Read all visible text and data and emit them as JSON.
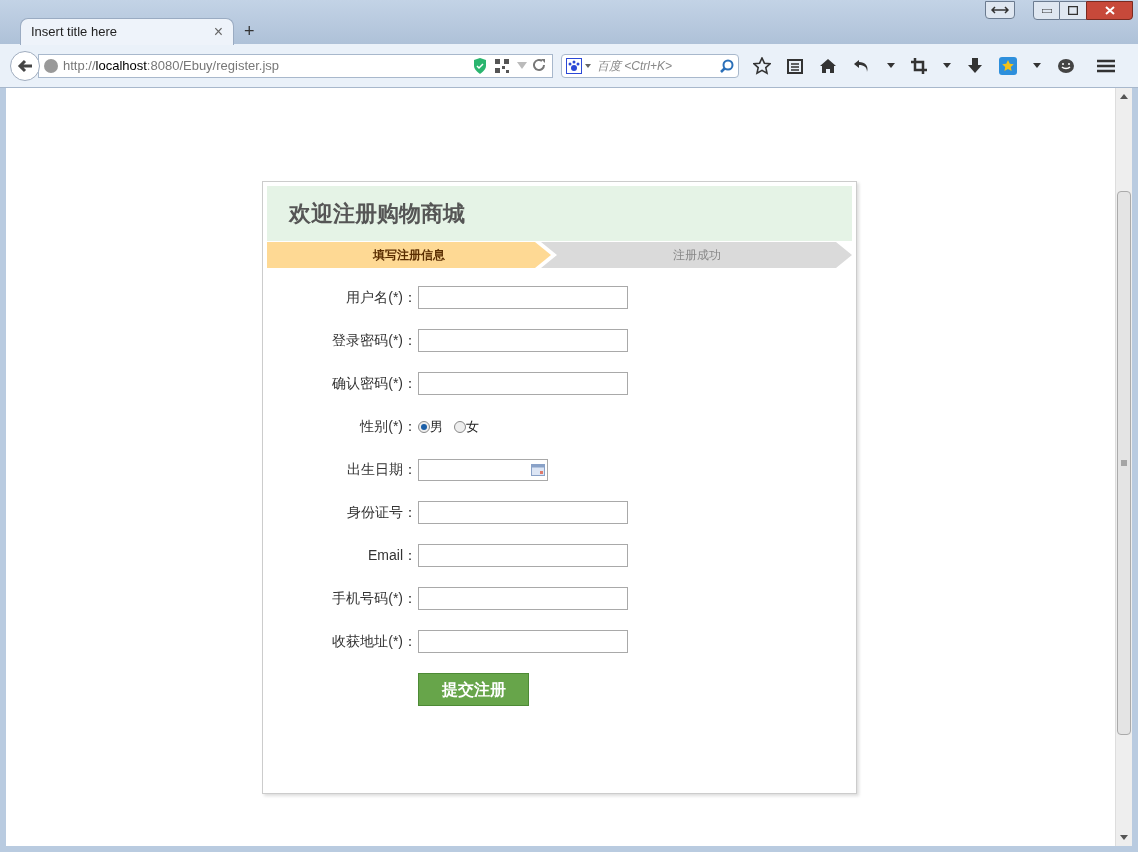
{
  "browser": {
    "tab_title": "Insert title here",
    "tab_close": "×",
    "new_tab": "+",
    "url_scheme": "http://",
    "url_host": "localhost",
    "url_rest": ":8080/Ebuy/register.jsp",
    "search_placeholder": "百度 <Ctrl+K>"
  },
  "form": {
    "title": "欢迎注册购物商城",
    "steps": [
      {
        "label": "填写注册信息",
        "selected": true
      },
      {
        "label": "注册成功",
        "selected": false
      }
    ],
    "fields": [
      {
        "kind": "text",
        "label": "用户名(*)："
      },
      {
        "kind": "text",
        "label": "登录密码(*)："
      },
      {
        "kind": "text",
        "label": "确认密码(*)："
      },
      {
        "kind": "radio",
        "label": "性别(*)：",
        "options": [
          {
            "label": "男",
            "selected": true
          },
          {
            "label": "女",
            "selected": false
          }
        ]
      },
      {
        "kind": "date",
        "label": "出生日期："
      },
      {
        "kind": "text",
        "label": "身份证号："
      },
      {
        "kind": "text",
        "label": "Email："
      },
      {
        "kind": "text",
        "label": "手机号码(*)："
      },
      {
        "kind": "text",
        "label": "收获地址(*)："
      }
    ],
    "submit": "提交注册"
  }
}
